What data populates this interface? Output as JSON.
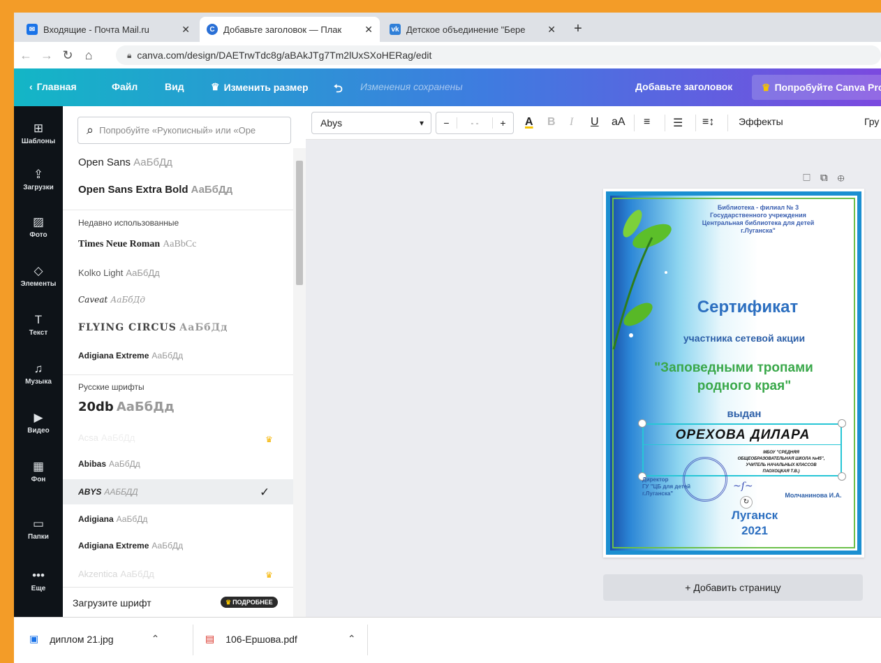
{
  "browser": {
    "tabs": [
      {
        "title": "Входящие - Почта Mail.ru",
        "icon": "mail-icon",
        "color": "#1a73e8"
      },
      {
        "title": "Добавьте заголовок — Плакат",
        "icon": "canva-icon",
        "color": "#2a70d6"
      },
      {
        "title": "Детское объединение \"Береста",
        "icon": "vk-icon",
        "color": "#2f7fd8"
      }
    ],
    "url": "canva.com/design/DAETrwTdc8g/aBAkJTg7Tm2lUxSXoHERag/edit"
  },
  "header": {
    "back_label": "Главная",
    "file_label": "Файл",
    "view_label": "Вид",
    "resize_label": "Изменить размер",
    "saved_status": "Изменения сохранены",
    "title_label": "Добавьте заголовок",
    "pro_label": "Попробуйте Canva Pro"
  },
  "rail": [
    {
      "label": "Шаблоны",
      "icon": "templates-icon"
    },
    {
      "label": "Загрузки",
      "icon": "upload-icon"
    },
    {
      "label": "Фото",
      "icon": "photo-icon"
    },
    {
      "label": "Элементы",
      "icon": "elements-icon"
    },
    {
      "label": "Текст",
      "icon": "text-icon"
    },
    {
      "label": "Музыка",
      "icon": "music-icon"
    },
    {
      "label": "Видео",
      "icon": "video-icon"
    },
    {
      "label": "Фон",
      "icon": "background-icon"
    },
    {
      "label": "Папки",
      "icon": "folder-icon"
    },
    {
      "label": "Еще",
      "icon": "more-icon"
    }
  ],
  "panel": {
    "search_placeholder": "Попробуйте «Рукописный» или «Оре",
    "top_fonts": [
      {
        "name": "Open Sans",
        "sample": "АаБбДд"
      },
      {
        "name": "Open Sans Extra Bold",
        "sample": "АаБбДд"
      }
    ],
    "recent_header": "Недавно использованные",
    "recent": [
      {
        "name": "Times Neue Roman",
        "sample": "AaBbCc"
      },
      {
        "name": "Kolko Light",
        "sample": "АаБбДд"
      },
      {
        "name": "Caveat",
        "sample": "АаБбДд"
      },
      {
        "name": "FLYING CIRCUS",
        "sample": "АаБбДд"
      },
      {
        "name": "Adigiana Extreme",
        "sample": "АаБбДд"
      }
    ],
    "russian_header": "Русские шрифты",
    "russian": [
      {
        "name": "20db",
        "sample": "АаБбДд",
        "pro": false
      },
      {
        "name": "Acsa",
        "sample": "АаБбДд",
        "pro": true
      },
      {
        "name": "Abibas",
        "sample": "АаБбДд",
        "pro": false
      },
      {
        "name": "ABYS",
        "sample": "ААББДД",
        "pro": false,
        "selected": true
      },
      {
        "name": "Adigiana",
        "sample": "АаБбДд",
        "pro": false
      },
      {
        "name": "Adigiana Extreme",
        "sample": "АаБбДд",
        "pro": false
      },
      {
        "name": "Akzentica",
        "sample": "АаБбДд",
        "pro": true
      }
    ],
    "upload_label": "Загрузите шрифт",
    "more_label": "ПОДРОБНЕЕ"
  },
  "toolbar": {
    "font_value": "Abys",
    "size_value": "- -",
    "effects_label": "Эффекты",
    "group_label": "Гру"
  },
  "certificate": {
    "library_lines": [
      "Библиотека - филиал № 3",
      "Государственного учреждения",
      "Центральная библиотека для детей",
      "г.Луганска\""
    ],
    "title": "Сертификат",
    "subtitle": "участника сетевой акции",
    "action_line1": "\"Заповедными тропами",
    "action_line2": "родного края\"",
    "issued": "выдан",
    "recipient": "ОРЕХОВА ДИЛАРА",
    "school_lines": [
      "МБОУ \"СРЕДНЯЯ",
      "ОБЩЕОБРАЗОВАТЕЛЬНАЯ ШКОЛА №45\",",
      "УЧИТЕЛЬ НАЧАЛЬНЫХ КЛАССОВ",
      "ПАОХОЦКАЯ Т.В.)"
    ],
    "director_lines": [
      "Директор",
      "ГУ \"ЦБ для детей",
      "г.Луганска\""
    ],
    "signer": "Молчанинова И.А.",
    "city": "Луганск",
    "year": "2021"
  },
  "canvas": {
    "add_page_label": "+ Добавить страницу"
  },
  "downloads": [
    {
      "name": "диплом 21.jpg",
      "icon": "image-file-icon"
    },
    {
      "name": "106-Ершова.pdf",
      "icon": "pdf-file-icon"
    }
  ]
}
